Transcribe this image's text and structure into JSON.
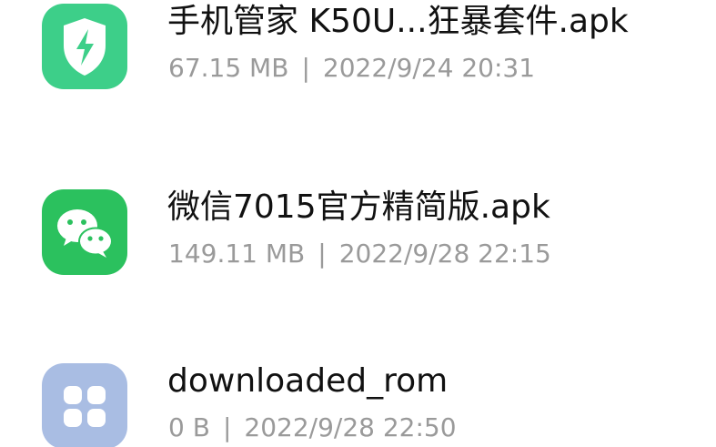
{
  "files": [
    {
      "icon": "security-shield-icon",
      "name": "手机管家 K50U...狂暴套件.apk",
      "size": "67.15 MB",
      "date": "2022/9/24 20:31"
    },
    {
      "icon": "wechat-icon",
      "name": "微信7015官方精简版.apk",
      "size": "149.11 MB",
      "date": "2022/9/28 22:15"
    },
    {
      "icon": "folder-grid-icon",
      "name": "downloaded_rom",
      "size": "0 B",
      "date": "2022/9/28 22:50"
    }
  ],
  "separator": "|",
  "colors": {
    "shield_icon_bg": "#3dcf89",
    "wechat_icon_bg": "#2bc15e",
    "folder_icon_bg": "#a9bde3",
    "name_text": "#111111",
    "meta_text": "#9a9a9a"
  }
}
